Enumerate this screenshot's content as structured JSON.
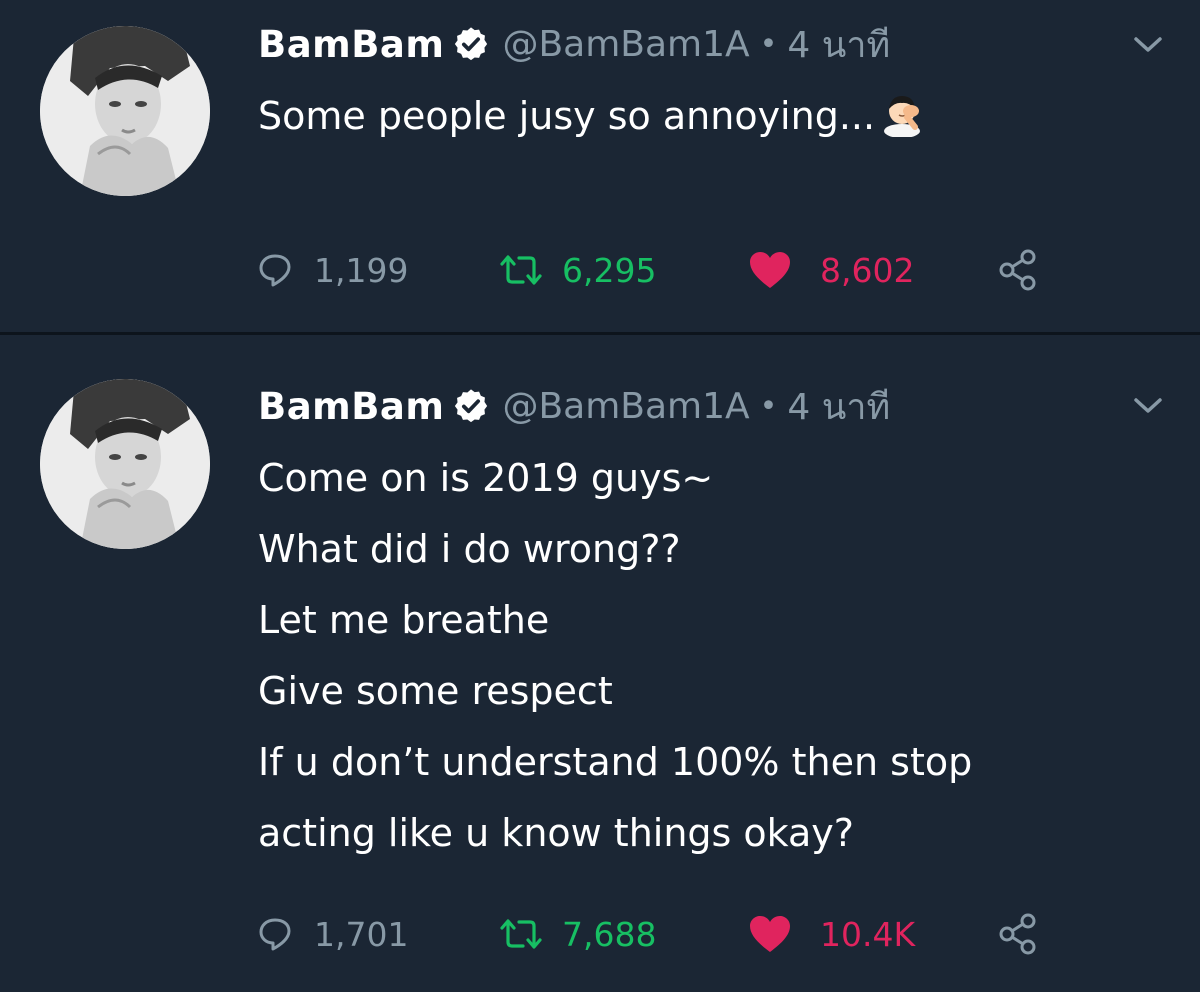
{
  "colors": {
    "background": "#1b2634",
    "secondary_text": "#8899a6",
    "retweet_green": "#17bf63",
    "like_red": "#e0245e"
  },
  "tweets": [
    {
      "display_name": "BamBam",
      "handle": "@BamBam1A",
      "separator": "•",
      "time": "4 นาที",
      "text_lines": [
        "Some people jusy so annoying..."
      ],
      "emoji": "facepalm-man-emoji",
      "replies": "1,199",
      "retweets": "6,295",
      "likes": "8,602"
    },
    {
      "display_name": "BamBam",
      "handle": "@BamBam1A",
      "separator": "•",
      "time": "4 นาที",
      "text_lines": [
        "Come on is 2019 guys~",
        "What did i do wrong??",
        "Let me breathe",
        "Give some respect",
        "If u don’t understand 100% then stop",
        "acting like u know things okay?"
      ],
      "replies": "1,701",
      "retweets": "7,688",
      "likes": "10.4K"
    }
  ]
}
